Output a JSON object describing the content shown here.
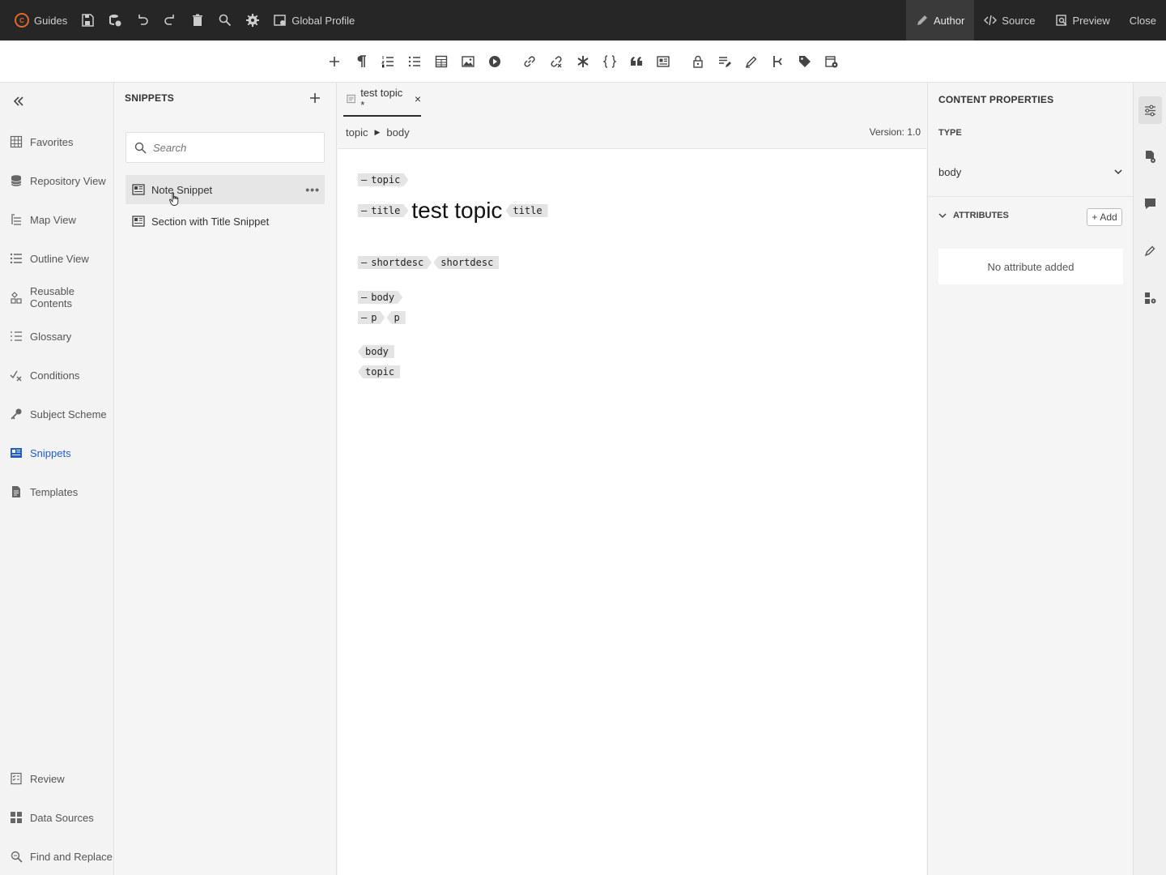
{
  "topbar": {
    "app_name": "Guides",
    "profile_label": "Global Profile",
    "modes": {
      "author": "Author",
      "source": "Source",
      "preview": "Preview",
      "close": "Close"
    }
  },
  "leftnav": {
    "items": [
      {
        "label": "Favorites",
        "icon": "grid-icon"
      },
      {
        "label": "Repository View",
        "icon": "database-icon"
      },
      {
        "label": "Map View",
        "icon": "map-list-icon"
      },
      {
        "label": "Outline View",
        "icon": "outline-icon"
      },
      {
        "label": "Reusable Contents",
        "icon": "reuse-icon"
      },
      {
        "label": "Glossary",
        "icon": "glossary-icon"
      },
      {
        "label": "Conditions",
        "icon": "conditions-icon"
      },
      {
        "label": "Subject Scheme",
        "icon": "key-icon"
      },
      {
        "label": "Snippets",
        "icon": "snippet-icon"
      },
      {
        "label": "Templates",
        "icon": "template-icon"
      }
    ],
    "bottom_items": [
      {
        "label": "Review",
        "icon": "review-icon"
      },
      {
        "label": "Data Sources",
        "icon": "data-sources-icon"
      },
      {
        "label": "Find and Replace",
        "icon": "find-replace-icon"
      }
    ],
    "active": "Snippets",
    "active_color": "#1f5dcc"
  },
  "snippets": {
    "title": "SNIPPETS",
    "search_placeholder": "Search",
    "items": [
      {
        "label": "Note Snippet"
      },
      {
        "label": "Section with Title Snippet"
      }
    ]
  },
  "editor": {
    "tab_label": "test topic *",
    "breadcrumb": [
      "topic",
      "body"
    ],
    "version": "Version: 1.0",
    "content": {
      "topic_open": "topic",
      "title_open": "title",
      "title_text": "test topic",
      "title_close": "title",
      "shortdesc_open": "shortdesc",
      "shortdesc_close": "shortdesc",
      "body_open": "body",
      "p_open": "p",
      "p_close": "p",
      "body_close": "body",
      "topic_close": "topic"
    }
  },
  "properties": {
    "title": "CONTENT PROPERTIES",
    "type_label": "TYPE",
    "type_value": "body",
    "attributes_label": "ATTRIBUTES",
    "add_label": "Add",
    "empty_message": "No attribute added"
  }
}
